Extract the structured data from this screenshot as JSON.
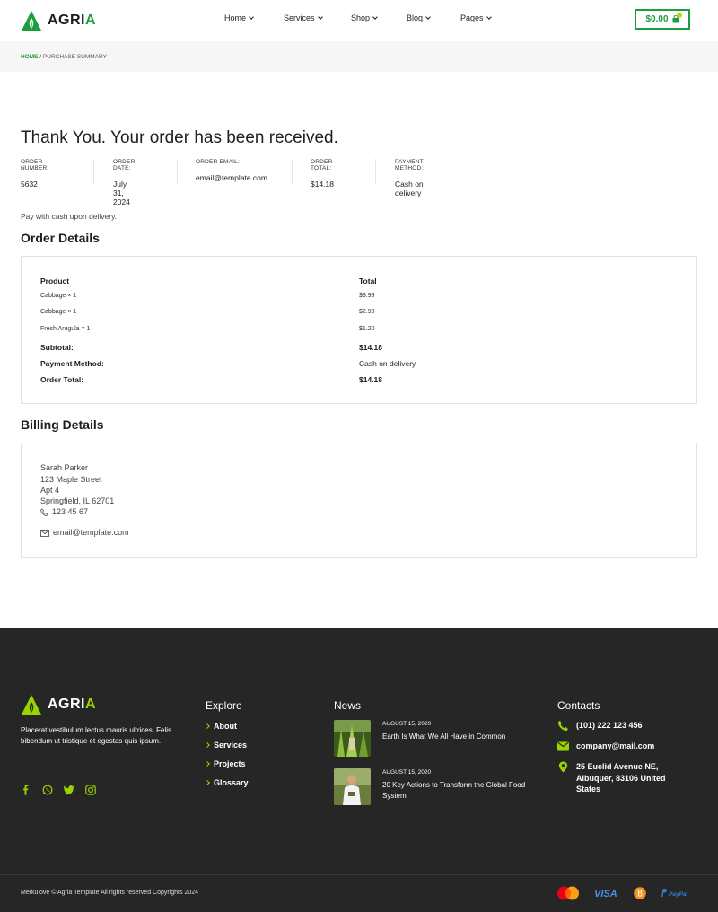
{
  "header": {
    "logo_text_1": "AGRI",
    "logo_text_2": "A",
    "nav": [
      {
        "label": "Home"
      },
      {
        "label": "Services"
      },
      {
        "label": "Shop"
      },
      {
        "label": "Blog"
      },
      {
        "label": "Pages"
      }
    ],
    "cart_total": "$0.00"
  },
  "breadcrumb": {
    "home": "HOME",
    "separator": " / ",
    "current": "PURCHASE SUMMARY"
  },
  "main": {
    "title": "Thank You. Your order has been received.",
    "meta": [
      {
        "label": "ORDER NUMBER:",
        "value": "5632"
      },
      {
        "label": "ORDER DATE:",
        "value": "July 31, 2024"
      },
      {
        "label": "ORDER EMAIL:",
        "value": "email@template.com"
      },
      {
        "label": "ORDER TOTAL:",
        "value": "$14.18"
      },
      {
        "label": "PAYMENT METHOD:",
        "value": "Cash on delivery"
      }
    ],
    "payment_note": "Pay with cash upon delivery.",
    "order_details_title": "Order Details",
    "order_table": {
      "headers": [
        "Product",
        "Total"
      ],
      "items": [
        {
          "product": "Cabbage × 1",
          "total": "$9.99"
        },
        {
          "product": "Cabbage × 1",
          "total": "$2.99"
        },
        {
          "product": "Fresh Arugula × 1",
          "total": "$1.20"
        }
      ],
      "summary": [
        {
          "label": "Subtotal:",
          "value": "$14.18"
        },
        {
          "label": "Payment Method:",
          "value": "Cash on delivery"
        },
        {
          "label": "Order Total:",
          "value": "$14.18"
        }
      ]
    },
    "billing_title": "Billing Details",
    "billing": {
      "name": "Sarah Parker",
      "street": "123 Maple Street",
      "apt": "Apt 4",
      "city": "Springfield, IL 62701",
      "phone": "123 45 67",
      "email": "email@template.com"
    }
  },
  "footer": {
    "logo_text_1": "AGRI",
    "logo_text_2": "A",
    "description": "Placerat vestibulum lectus mauris ultrices. Felis bibendum ut tristique et egestas quis ipsum.",
    "explore_title": "Explore",
    "explore_links": [
      "About",
      "Services",
      "Projects",
      "Glossary"
    ],
    "news_title": "News",
    "news": [
      {
        "date": "AUGUST 15, 2020",
        "title": "Earth Is What We All Have in Common"
      },
      {
        "date": "AUGUST 15, 2020",
        "title": "20 Key Actions to Transform the Global Food System"
      }
    ],
    "contacts_title": "Contacts",
    "contacts": {
      "phone": "(101) 222 123 456",
      "email": "company@mail.com",
      "address": "25 Euclid Avenue NE, Albuquer, 83106 United States"
    },
    "copyright": "Merkulove © Agria Template All rights reserved Copyrights 2024",
    "payment_icons": [
      "mastercard-icon",
      "visa-icon",
      "bitcoin-icon",
      "paypal-icon"
    ],
    "payment_labels": {
      "visa": "VISA",
      "paypal": "PayPal"
    }
  },
  "colors": {
    "brand_green": "#1a9e3f",
    "footer_accent": "#9ad400",
    "footer_bg": "#262626"
  }
}
